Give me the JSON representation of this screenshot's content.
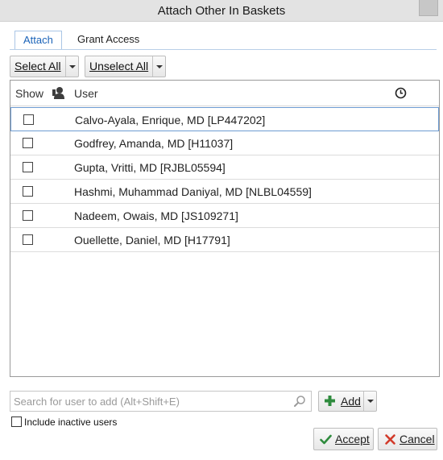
{
  "window": {
    "title": "Attach Other In Baskets"
  },
  "tabs": [
    {
      "label": "Attach",
      "active": true
    },
    {
      "label": "Grant Access",
      "active": false
    }
  ],
  "toolbar": {
    "select_all_label": "Select All",
    "unselect_all_label": "Unselect All"
  },
  "grid": {
    "columns": {
      "show": "Show",
      "user": "User"
    },
    "header_icons": [
      "person-icon",
      "clock-icon"
    ],
    "rows": [
      {
        "name": "Calvo-Ayala, Enrique, MD [LP447202]",
        "checked": false,
        "selected": true
      },
      {
        "name": "Godfrey, Amanda, MD [H11037]",
        "checked": false
      },
      {
        "name": "Gupta, Vritti, MD [RJBL05594]",
        "checked": false
      },
      {
        "name": "Hashmi, Muhammad Daniyal, MD [NLBL04559]",
        "checked": false
      },
      {
        "name": "Nadeem, Owais, MD [JS109271]",
        "checked": false
      },
      {
        "name": "Ouellette, Daniel, MD [H17791]",
        "checked": false
      }
    ]
  },
  "search": {
    "placeholder": "Search for user to add (Alt+Shift+E)",
    "value": ""
  },
  "add_button": {
    "label": "Add"
  },
  "include_inactive": {
    "label": "Include inactive users",
    "checked": false
  },
  "footer": {
    "accept_label": "Accept",
    "cancel_label": "Cancel"
  },
  "colors": {
    "accent": "#1b63b8",
    "accept_green": "#2e8b3d",
    "cancel_red": "#d23a2a"
  }
}
